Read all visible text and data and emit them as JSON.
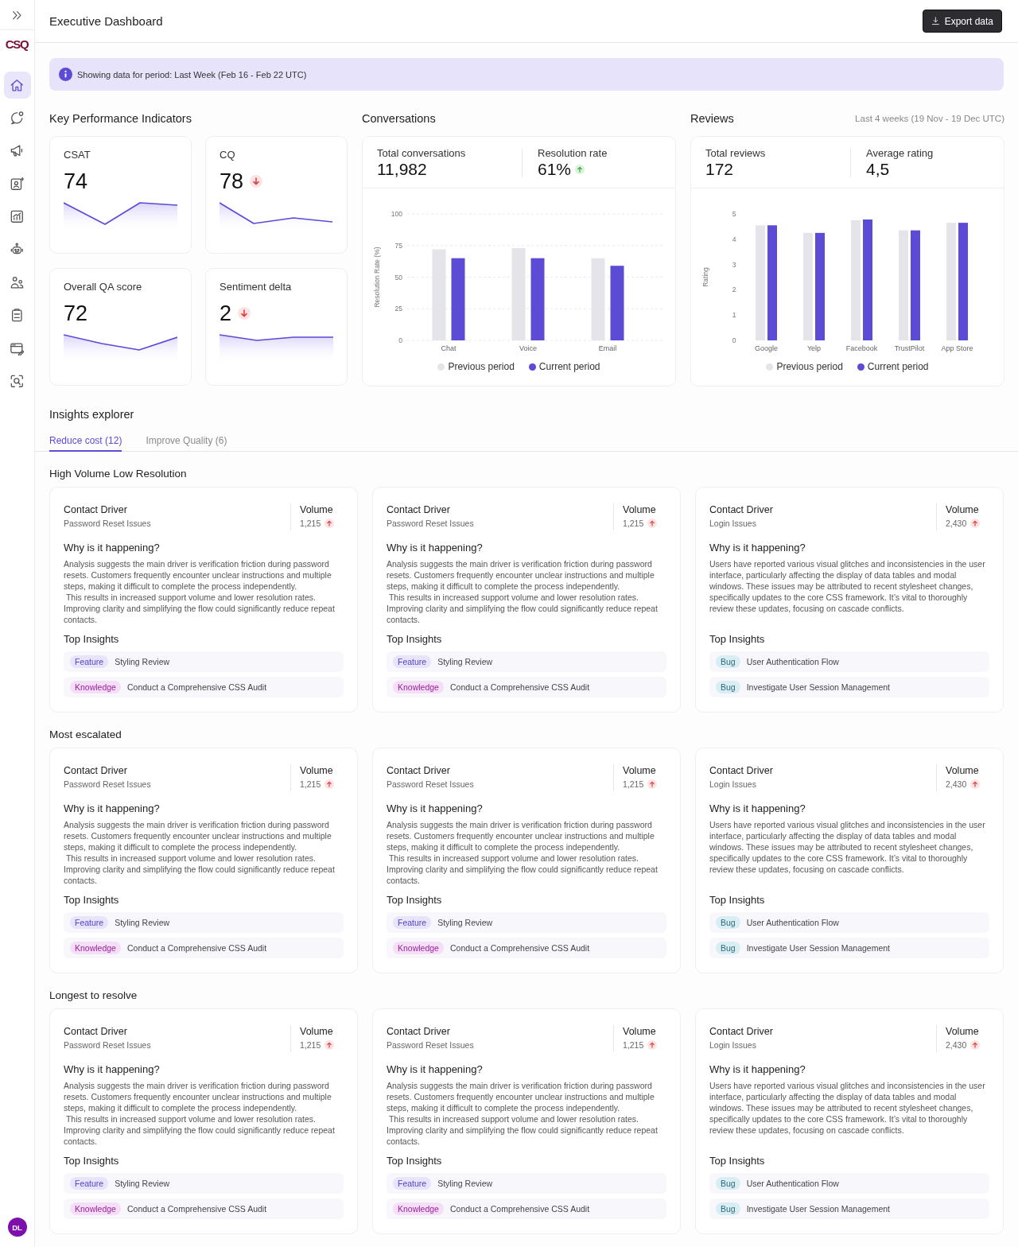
{
  "sidebar": {
    "logo": "CSQ",
    "items": [
      {
        "selected": true
      },
      {
        "selected": false
      },
      {
        "selected": false
      },
      {
        "selected": false
      },
      {
        "selected": false
      },
      {
        "selected": false
      },
      {
        "selected": false
      },
      {
        "selected": false
      },
      {
        "selected": false
      },
      {
        "selected": false
      }
    ],
    "avatar": "DL"
  },
  "header": {
    "title": "Executive Dashboard",
    "export_button": "Export data"
  },
  "banner": {
    "text": "Showing data for period: Last Week (Feb 16 - Feb 22 UTC)"
  },
  "kpi": {
    "title": "Key Performance Indicators",
    "cards": [
      {
        "label": "CSAT",
        "value": "74"
      },
      {
        "label": "CQ",
        "value": "78",
        "trend_up": false,
        "trend_good": false
      },
      {
        "label": "Overall QA score",
        "value": "72"
      },
      {
        "label": "Sentiment delta",
        "value": "2",
        "trend_up": false,
        "trend_good": false
      }
    ]
  },
  "conversations": {
    "title": "Conversations",
    "stats": [
      {
        "label": "Total conversations",
        "value": "11,982"
      },
      {
        "label": "Resolution rate",
        "value": "61%",
        "trend_up": true,
        "trend_good": true
      }
    ],
    "chart_data": {
      "type": "bar",
      "ylabel": "Resolution Rate (%)",
      "categories": [
        "Chat",
        "Voice",
        "Email"
      ],
      "series": [
        {
          "name": "Previous period",
          "color": "#e4e4ea",
          "values": [
            72,
            73,
            65
          ]
        },
        {
          "name": "Current period",
          "color": "#5b4bd5",
          "values": [
            65,
            65,
            59
          ]
        }
      ],
      "ylim": [
        0,
        100
      ],
      "yticks": [
        0,
        25,
        50,
        75,
        100
      ],
      "grid": true,
      "legend": "bottom"
    }
  },
  "reviews": {
    "title": "Reviews",
    "period": "Last 4 weeks (19 Nov - 19 Dec UTC)",
    "stats": [
      {
        "label": "Total reviews",
        "value": "172"
      },
      {
        "label": "Average rating",
        "value": "4,5"
      }
    ],
    "chart_data": {
      "type": "bar",
      "ylabel": "Rating",
      "categories": [
        "Google",
        "Yelp",
        "Facebook",
        "TrustPilot",
        "App Store"
      ],
      "series": [
        {
          "name": "Previous period",
          "color": "#e4e4ea",
          "values": [
            4.55,
            4.25,
            4.75,
            4.35,
            4.65
          ]
        },
        {
          "name": "Current period",
          "color": "#5b4bd5",
          "values": [
            4.55,
            4.25,
            4.78,
            4.35,
            4.65
          ]
        }
      ],
      "ylim": [
        0,
        5
      ],
      "yticks": [
        0,
        1,
        2,
        3,
        4,
        5
      ],
      "grid": false,
      "legend": "bottom"
    }
  },
  "insights": {
    "title": "Insights explorer",
    "tabs": [
      {
        "label": "Reduce cost (12)",
        "selected": true
      },
      {
        "label": "Improve Quality (6)",
        "selected": false
      }
    ],
    "groups": [
      {
        "title": "High Volume Low Resolution",
        "cards": [
          {
            "driver_label": "Contact Driver",
            "driver": "Password Reset Issues",
            "volume_label": "Volume",
            "volume": "1,215",
            "trend_up": true,
            "trend_good": false,
            "why_label": "Why is it happening?",
            "why": "Analysis suggests the main driver is verification friction during password resets. Customers frequently encounter unclear instructions and multiple steps, making it difficult to complete the process independently.\n This results in increased support volume and lower resolution rates. Improving clarity and simplifying the flow could significantly reduce repeat contacts.",
            "insights_label": "Top Insights",
            "insights": [
              {
                "kind": "feature",
                "tag": "Feature",
                "title": "Styling Review"
              },
              {
                "kind": "knowledge",
                "tag": "Knowledge",
                "title": "Conduct a Comprehensive CSS Audit"
              }
            ]
          },
          {
            "driver_label": "Contact Driver",
            "driver": "Password Reset Issues",
            "volume_label": "Volume",
            "volume": "1,215",
            "trend_up": true,
            "trend_good": false,
            "why_label": "Why is it happening?",
            "why": "Analysis suggests the main driver is verification friction during password resets. Customers frequently encounter unclear instructions and multiple steps, making it difficult to complete the process independently.\n This results in increased support volume and lower resolution rates. Improving clarity and simplifying the flow could significantly reduce repeat contacts.",
            "insights_label": "Top Insights",
            "insights": [
              {
                "kind": "feature",
                "tag": "Feature",
                "title": "Styling Review"
              },
              {
                "kind": "knowledge",
                "tag": "Knowledge",
                "title": "Conduct a Comprehensive CSS Audit"
              }
            ]
          },
          {
            "driver_label": "Contact Driver",
            "driver": "Login Issues",
            "volume_label": "Volume",
            "volume": "2,430",
            "trend_up": true,
            "trend_good": false,
            "why_label": "Why is it happening?",
            "why": "Users have reported various visual glitches and inconsistencies in the user interface, particularly affecting the display of data tables and modal windows. These issues may be attributed to recent stylesheet changes, specifically updates to the core CSS framework. It’s vital to thoroughly review these updates, focusing on cascade conflicts.",
            "insights_label": "Top Insights",
            "insights": [
              {
                "kind": "bug",
                "tag": "Bug",
                "title": "User Authentication Flow"
              },
              {
                "kind": "bug",
                "tag": "Bug",
                "title": "Investigate User Session Management"
              }
            ]
          }
        ]
      },
      {
        "title": "Most escalated",
        "cards": [
          {
            "driver_label": "Contact Driver",
            "driver": "Password Reset Issues",
            "volume_label": "Volume",
            "volume": "1,215",
            "trend_up": true,
            "trend_good": false,
            "why_label": "Why is it happening?",
            "why": "Analysis suggests the main driver is verification friction during password resets. Customers frequently encounter unclear instructions and multiple steps, making it difficult to complete the process independently.\n This results in increased support volume and lower resolution rates. Improving clarity and simplifying the flow could significantly reduce repeat contacts.",
            "insights_label": "Top Insights",
            "insights": [
              {
                "kind": "feature",
                "tag": "Feature",
                "title": "Styling Review"
              },
              {
                "kind": "knowledge",
                "tag": "Knowledge",
                "title": "Conduct a Comprehensive CSS Audit"
              }
            ]
          },
          {
            "driver_label": "Contact Driver",
            "driver": "Password Reset Issues",
            "volume_label": "Volume",
            "volume": "1,215",
            "trend_up": true,
            "trend_good": false,
            "why_label": "Why is it happening?",
            "why": "Analysis suggests the main driver is verification friction during password resets. Customers frequently encounter unclear instructions and multiple steps, making it difficult to complete the process independently.\n This results in increased support volume and lower resolution rates. Improving clarity and simplifying the flow could significantly reduce repeat contacts.",
            "insights_label": "Top Insights",
            "insights": [
              {
                "kind": "feature",
                "tag": "Feature",
                "title": "Styling Review"
              },
              {
                "kind": "knowledge",
                "tag": "Knowledge",
                "title": "Conduct a Comprehensive CSS Audit"
              }
            ]
          },
          {
            "driver_label": "Contact Driver",
            "driver": "Login Issues",
            "volume_label": "Volume",
            "volume": "2,430",
            "trend_up": true,
            "trend_good": false,
            "why_label": "Why is it happening?",
            "why": "Users have reported various visual glitches and inconsistencies in the user interface, particularly affecting the display of data tables and modal windows. These issues may be attributed to recent stylesheet changes, specifically updates to the core CSS framework. It’s vital to thoroughly review these updates, focusing on cascade conflicts.",
            "insights_label": "Top Insights",
            "insights": [
              {
                "kind": "bug",
                "tag": "Bug",
                "title": "User Authentication Flow"
              },
              {
                "kind": "bug",
                "tag": "Bug",
                "title": "Investigate User Session Management"
              }
            ]
          }
        ]
      },
      {
        "title": "Longest to resolve",
        "cards": [
          {
            "driver_label": "Contact Driver",
            "driver": "Password Reset Issues",
            "volume_label": "Volume",
            "volume": "1,215",
            "trend_up": true,
            "trend_good": false,
            "why_label": "Why is it happening?",
            "why": "Analysis suggests the main driver is verification friction during password resets. Customers frequently encounter unclear instructions and multiple steps, making it difficult to complete the process independently.\n This results in increased support volume and lower resolution rates. Improving clarity and simplifying the flow could significantly reduce repeat contacts.",
            "insights_label": "Top Insights",
            "insights": [
              {
                "kind": "feature",
                "tag": "Feature",
                "title": "Styling Review"
              },
              {
                "kind": "knowledge",
                "tag": "Knowledge",
                "title": "Conduct a Comprehensive CSS Audit"
              }
            ]
          },
          {
            "driver_label": "Contact Driver",
            "driver": "Password Reset Issues",
            "volume_label": "Volume",
            "volume": "1,215",
            "trend_up": true,
            "trend_good": false,
            "why_label": "Why is it happening?",
            "why": "Analysis suggests the main driver is verification friction during password resets. Customers frequently encounter unclear instructions and multiple steps, making it difficult to complete the process independently.\n This results in increased support volume and lower resolution rates. Improving clarity and simplifying the flow could significantly reduce repeat contacts.",
            "insights_label": "Top Insights",
            "insights": [
              {
                "kind": "feature",
                "tag": "Feature",
                "title": "Styling Review"
              },
              {
                "kind": "knowledge",
                "tag": "Knowledge",
                "title": "Conduct a Comprehensive CSS Audit"
              }
            ]
          },
          {
            "driver_label": "Contact Driver",
            "driver": "Login Issues",
            "volume_label": "Volume",
            "volume": "2,430",
            "trend_up": true,
            "trend_good": false,
            "why_label": "Why is it happening?",
            "why": "Users have reported various visual glitches and inconsistencies in the user interface, particularly affecting the display of data tables and modal windows. These issues may be attributed to recent stylesheet changes, specifically updates to the core CSS framework. It’s vital to thoroughly review these updates, focusing on cascade conflicts.",
            "insights_label": "Top Insights",
            "insights": [
              {
                "kind": "bug",
                "tag": "Bug",
                "title": "User Authentication Flow"
              },
              {
                "kind": "bug",
                "tag": "Bug",
                "title": "Investigate User Session Management"
              }
            ]
          }
        ]
      }
    ]
  }
}
